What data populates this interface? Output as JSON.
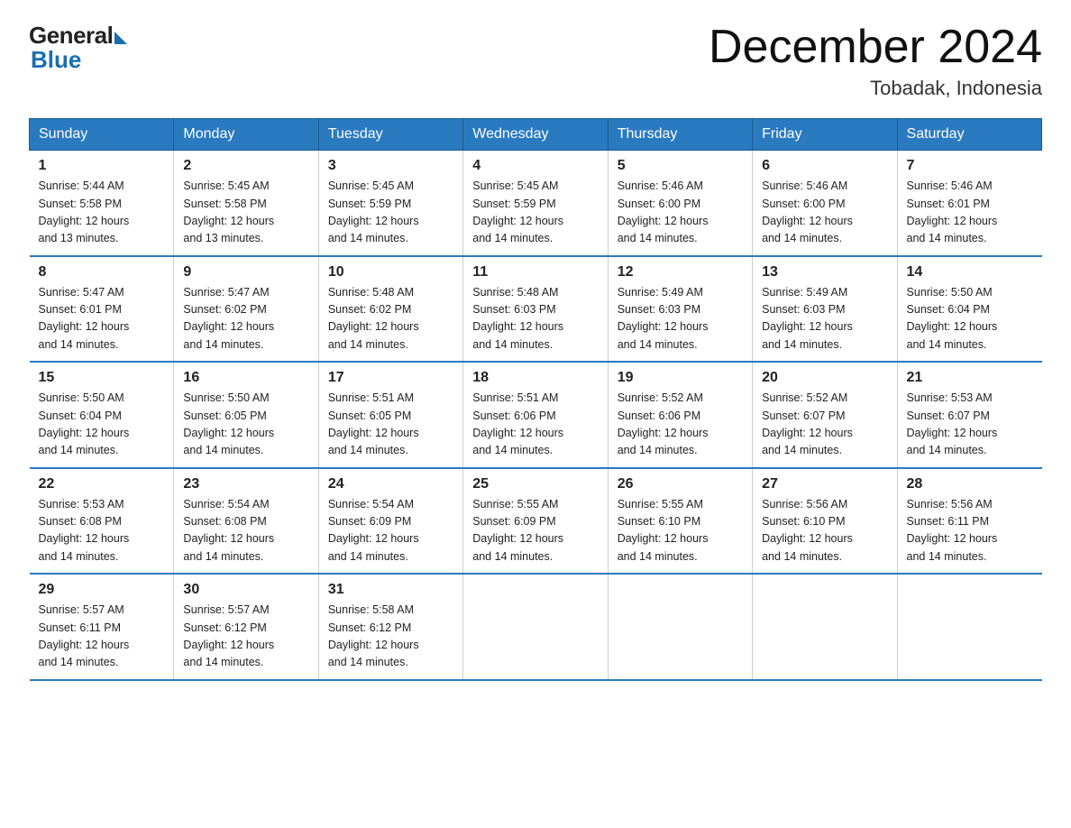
{
  "logo": {
    "general": "General",
    "blue": "Blue"
  },
  "header": {
    "month_year": "December 2024",
    "location": "Tobadak, Indonesia"
  },
  "days_of_week": [
    "Sunday",
    "Monday",
    "Tuesday",
    "Wednesday",
    "Thursday",
    "Friday",
    "Saturday"
  ],
  "weeks": [
    [
      {
        "day": "1",
        "sunrise": "5:44 AM",
        "sunset": "5:58 PM",
        "daylight": "12 hours and 13 minutes."
      },
      {
        "day": "2",
        "sunrise": "5:45 AM",
        "sunset": "5:58 PM",
        "daylight": "12 hours and 13 minutes."
      },
      {
        "day": "3",
        "sunrise": "5:45 AM",
        "sunset": "5:59 PM",
        "daylight": "12 hours and 14 minutes."
      },
      {
        "day": "4",
        "sunrise": "5:45 AM",
        "sunset": "5:59 PM",
        "daylight": "12 hours and 14 minutes."
      },
      {
        "day": "5",
        "sunrise": "5:46 AM",
        "sunset": "6:00 PM",
        "daylight": "12 hours and 14 minutes."
      },
      {
        "day": "6",
        "sunrise": "5:46 AM",
        "sunset": "6:00 PM",
        "daylight": "12 hours and 14 minutes."
      },
      {
        "day": "7",
        "sunrise": "5:46 AM",
        "sunset": "6:01 PM",
        "daylight": "12 hours and 14 minutes."
      }
    ],
    [
      {
        "day": "8",
        "sunrise": "5:47 AM",
        "sunset": "6:01 PM",
        "daylight": "12 hours and 14 minutes."
      },
      {
        "day": "9",
        "sunrise": "5:47 AM",
        "sunset": "6:02 PM",
        "daylight": "12 hours and 14 minutes."
      },
      {
        "day": "10",
        "sunrise": "5:48 AM",
        "sunset": "6:02 PM",
        "daylight": "12 hours and 14 minutes."
      },
      {
        "day": "11",
        "sunrise": "5:48 AM",
        "sunset": "6:03 PM",
        "daylight": "12 hours and 14 minutes."
      },
      {
        "day": "12",
        "sunrise": "5:49 AM",
        "sunset": "6:03 PM",
        "daylight": "12 hours and 14 minutes."
      },
      {
        "day": "13",
        "sunrise": "5:49 AM",
        "sunset": "6:03 PM",
        "daylight": "12 hours and 14 minutes."
      },
      {
        "day": "14",
        "sunrise": "5:50 AM",
        "sunset": "6:04 PM",
        "daylight": "12 hours and 14 minutes."
      }
    ],
    [
      {
        "day": "15",
        "sunrise": "5:50 AM",
        "sunset": "6:04 PM",
        "daylight": "12 hours and 14 minutes."
      },
      {
        "day": "16",
        "sunrise": "5:50 AM",
        "sunset": "6:05 PM",
        "daylight": "12 hours and 14 minutes."
      },
      {
        "day": "17",
        "sunrise": "5:51 AM",
        "sunset": "6:05 PM",
        "daylight": "12 hours and 14 minutes."
      },
      {
        "day": "18",
        "sunrise": "5:51 AM",
        "sunset": "6:06 PM",
        "daylight": "12 hours and 14 minutes."
      },
      {
        "day": "19",
        "sunrise": "5:52 AM",
        "sunset": "6:06 PM",
        "daylight": "12 hours and 14 minutes."
      },
      {
        "day": "20",
        "sunrise": "5:52 AM",
        "sunset": "6:07 PM",
        "daylight": "12 hours and 14 minutes."
      },
      {
        "day": "21",
        "sunrise": "5:53 AM",
        "sunset": "6:07 PM",
        "daylight": "12 hours and 14 minutes."
      }
    ],
    [
      {
        "day": "22",
        "sunrise": "5:53 AM",
        "sunset": "6:08 PM",
        "daylight": "12 hours and 14 minutes."
      },
      {
        "day": "23",
        "sunrise": "5:54 AM",
        "sunset": "6:08 PM",
        "daylight": "12 hours and 14 minutes."
      },
      {
        "day": "24",
        "sunrise": "5:54 AM",
        "sunset": "6:09 PM",
        "daylight": "12 hours and 14 minutes."
      },
      {
        "day": "25",
        "sunrise": "5:55 AM",
        "sunset": "6:09 PM",
        "daylight": "12 hours and 14 minutes."
      },
      {
        "day": "26",
        "sunrise": "5:55 AM",
        "sunset": "6:10 PM",
        "daylight": "12 hours and 14 minutes."
      },
      {
        "day": "27",
        "sunrise": "5:56 AM",
        "sunset": "6:10 PM",
        "daylight": "12 hours and 14 minutes."
      },
      {
        "day": "28",
        "sunrise": "5:56 AM",
        "sunset": "6:11 PM",
        "daylight": "12 hours and 14 minutes."
      }
    ],
    [
      {
        "day": "29",
        "sunrise": "5:57 AM",
        "sunset": "6:11 PM",
        "daylight": "12 hours and 14 minutes."
      },
      {
        "day": "30",
        "sunrise": "5:57 AM",
        "sunset": "6:12 PM",
        "daylight": "12 hours and 14 minutes."
      },
      {
        "day": "31",
        "sunrise": "5:58 AM",
        "sunset": "6:12 PM",
        "daylight": "12 hours and 14 minutes."
      },
      null,
      null,
      null,
      null
    ]
  ],
  "labels": {
    "sunrise": "Sunrise:",
    "sunset": "Sunset:",
    "daylight": "Daylight:"
  }
}
